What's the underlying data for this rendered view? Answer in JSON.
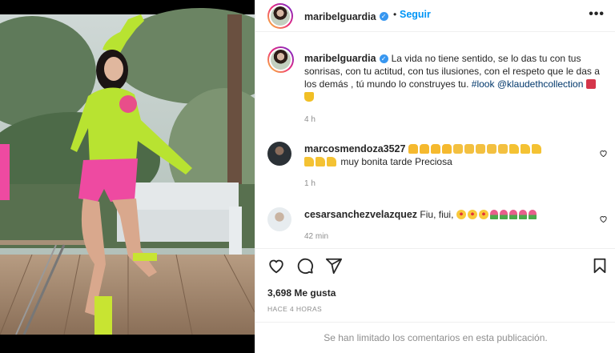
{
  "post": {
    "author": "maribelguardia",
    "follow_label": "Seguir",
    "more_label": "•••",
    "dot": "•"
  },
  "caption": {
    "username": "maribelguardia",
    "text": "La vida no tiene sentido, se lo das tu con tus sonrisas, con tu actitud, con tus ilusiones, con el respeto que le das a los demás , tú mundo lo construyes tu.",
    "hashtag": "#look",
    "mention": "@klaudethcollection",
    "time": "4 h",
    "emojis": [
      "shirt-emoji",
      "dress-emoji"
    ]
  },
  "comments": [
    {
      "username": "marcosmendoza3527",
      "line1_emojis": [
        "hug",
        "hug",
        "hug",
        "hug",
        "clap",
        "clap",
        "clap",
        "clap",
        "clap",
        "thumb",
        "thumb",
        "thumb"
      ],
      "line2_emojis": [
        "thumb",
        "thumb",
        "thumb"
      ],
      "text": "muy bonita tarde Preciosa",
      "time": "1 h"
    },
    {
      "username": "cesarsanchezvelazquez",
      "text": "Fiu, fiui,",
      "emojis": [
        "star",
        "star",
        "star",
        "tulip",
        "tulip",
        "tulip",
        "tulip",
        "tulip"
      ],
      "time": "42 min"
    }
  ],
  "actions": {
    "likes": "3,698 Me gusta",
    "posted": "HACE 4 HORAS",
    "limited_notice": "Se han limitado los comentarios en esta publicación."
  },
  "colors": {
    "link": "#0095f6",
    "hashtag": "#00376b",
    "muted": "#8e8e8e",
    "verified": "#3897f0"
  },
  "icons": [
    "heart-icon",
    "comment-icon",
    "share-icon",
    "bookmark-icon",
    "verified-icon",
    "more-icon"
  ]
}
